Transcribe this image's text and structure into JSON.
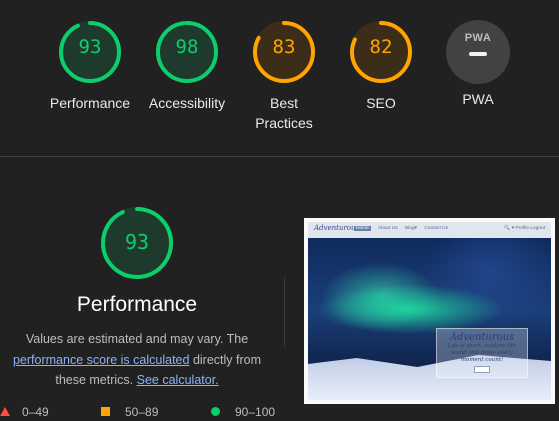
{
  "categories": [
    {
      "label": "Performance",
      "score": 93,
      "color": "#0cce6b"
    },
    {
      "label": "Accessibility",
      "score": 98,
      "color": "#0cce6b"
    },
    {
      "label": "Best Practices",
      "score": 83,
      "color": "#ffa400"
    },
    {
      "label": "SEO",
      "score": 82,
      "color": "#ffa400"
    },
    {
      "label": "PWA",
      "icon": "pwa-badge-icon",
      "icon_text": "PWA"
    }
  ],
  "performance": {
    "score": 93,
    "title": "Performance",
    "desc_1": "Values are estimated and may vary. The",
    "link_score": "performance score is calculated",
    "desc_2": "directly from",
    "desc_3": "these metrics.",
    "link_calc": "See calculator."
  },
  "legend": [
    {
      "range": "0–49",
      "color": "#ff4e42",
      "shape": "triangle"
    },
    {
      "range": "50–89",
      "color": "#ffa400",
      "shape": "square"
    },
    {
      "range": "90–100",
      "color": "#0cce6b",
      "shape": "circle"
    }
  ],
  "screenshot": {
    "logo": "Adventurous",
    "nav": [
      "Home",
      "About Us",
      "Blog▾",
      "Contact Us"
    ],
    "nav_right": "🔍 ▾  Profile  Logout",
    "hero_title": "Adventurous",
    "hero_text": "Life is short, explore the world and make every moment count!"
  }
}
